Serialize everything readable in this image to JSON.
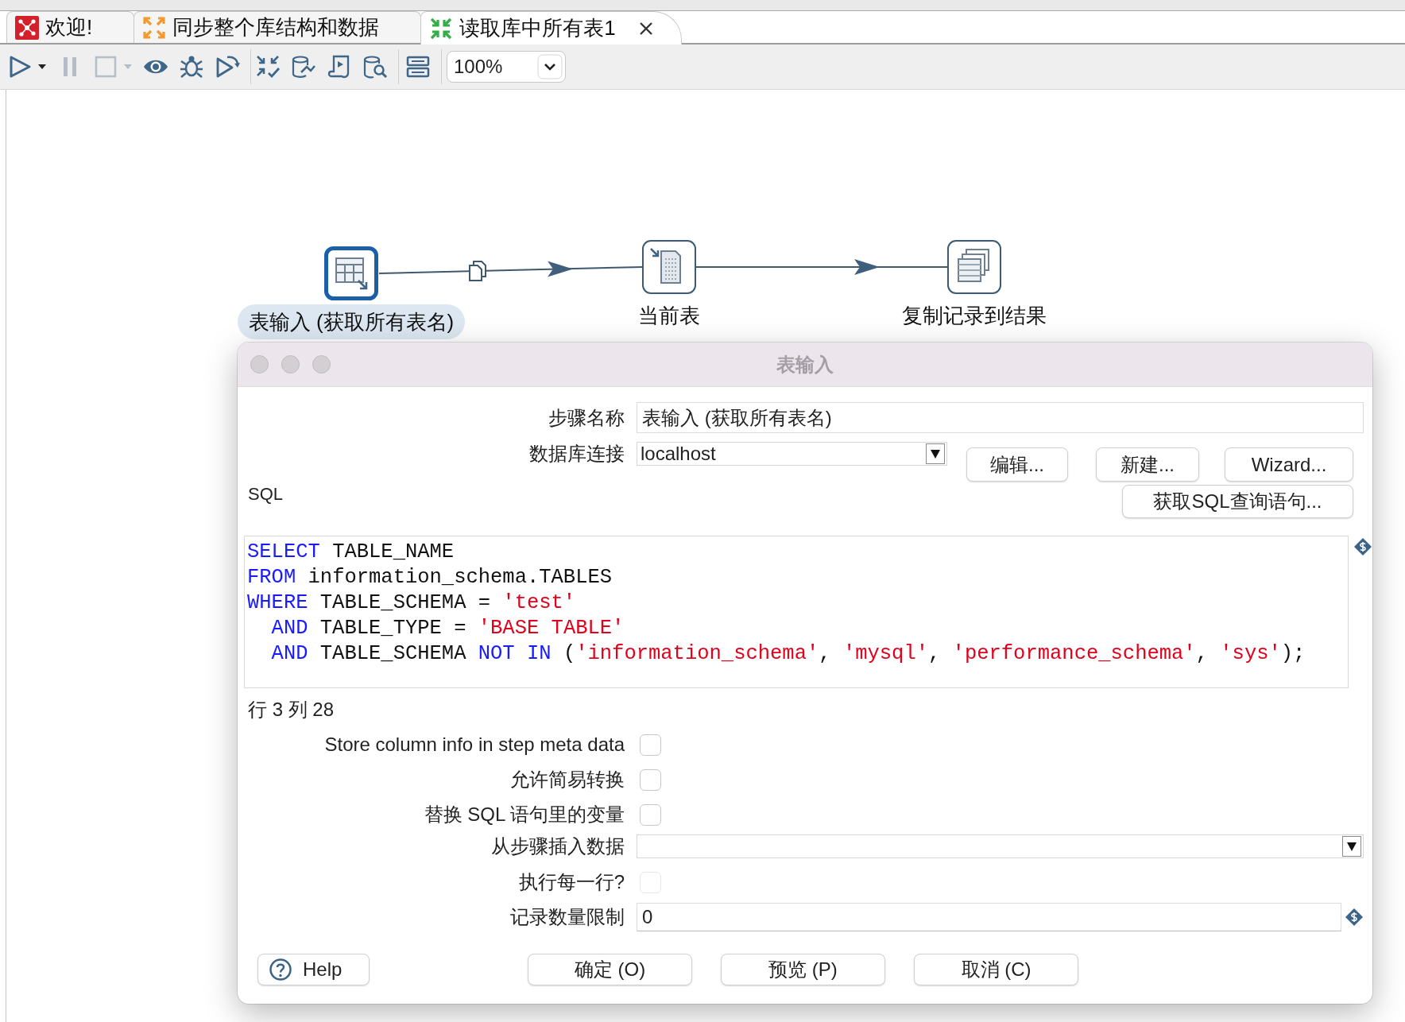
{
  "tabs": [
    {
      "label": "欢迎!",
      "kind": "welcome",
      "selected": false,
      "closable": false
    },
    {
      "label": "同步整个库结构和数据",
      "kind": "job",
      "selected": false,
      "closable": false
    },
    {
      "label": "读取库中所有表1",
      "kind": "transformation",
      "selected": true,
      "closable": true
    }
  ],
  "toolbar": {
    "groups": [
      [
        {
          "kind": "run",
          "dropdown": true,
          "disabled": false
        },
        {
          "kind": "pause",
          "dropdown": false,
          "disabled": true
        },
        {
          "kind": "stop",
          "dropdown": true,
          "disabled": true
        },
        {
          "kind": "preview",
          "dropdown": false,
          "disabled": false
        },
        {
          "kind": "debug",
          "dropdown": false,
          "disabled": false
        },
        {
          "kind": "replay",
          "dropdown": false,
          "disabled": false
        }
      ],
      [
        {
          "kind": "verify",
          "dropdown": false,
          "disabled": false
        },
        {
          "kind": "impact",
          "dropdown": false,
          "disabled": false
        },
        {
          "kind": "sql",
          "dropdown": false,
          "disabled": false
        },
        {
          "kind": "explore",
          "dropdown": false,
          "disabled": false
        }
      ],
      [
        {
          "kind": "layout",
          "dropdown": false,
          "disabled": false
        }
      ]
    ],
    "zoom": "100%"
  },
  "canvas": {
    "steps": [
      {
        "name": "表输入 (获取所有表名)",
        "kind": "table-input",
        "selected": true
      },
      {
        "name": "当前表",
        "kind": "current-table",
        "selected": false
      },
      {
        "name": "复制记录到结果",
        "kind": "copy-rows",
        "selected": false
      }
    ],
    "hops": [
      {
        "copy": true
      },
      {
        "copy": false
      }
    ]
  },
  "dialog": {
    "title": "表输入",
    "step_name": {
      "label": "步骤名称",
      "value": "表输入 (获取所有表名)"
    },
    "connection": {
      "label": "数据库连接",
      "value": "localhost",
      "buttons": [
        "编辑...",
        "新建...",
        "Wizard..."
      ]
    },
    "sql": {
      "label": "SQL",
      "button": "获取SQL查询语句...",
      "variable": true,
      "lines": [
        {
          "indented": false,
          "tokens": [
            {
              "kind": "keyword",
              "text": "SELECT"
            },
            {
              "kind": "plain",
              "text": " TABLE_NAME"
            }
          ]
        },
        {
          "indented": false,
          "tokens": [
            {
              "kind": "keyword",
              "text": "FROM"
            },
            {
              "kind": "plain",
              "text": " information_schema.TABLES"
            }
          ]
        },
        {
          "indented": false,
          "tokens": [
            {
              "kind": "keyword",
              "text": "WHERE"
            },
            {
              "kind": "plain",
              "text": " TABLE_SCHEMA = "
            },
            {
              "kind": "string",
              "text": "'test'"
            }
          ]
        },
        {
          "indented": true,
          "tokens": [
            {
              "kind": "keyword",
              "text": "AND"
            },
            {
              "kind": "plain",
              "text": " TABLE_TYPE = "
            },
            {
              "kind": "string",
              "text": "'BASE TABLE'"
            }
          ]
        },
        {
          "indented": true,
          "tokens": [
            {
              "kind": "keyword",
              "text": "AND"
            },
            {
              "kind": "plain",
              "text": " TABLE_SCHEMA "
            },
            {
              "kind": "keyword",
              "text": "NOT IN"
            },
            {
              "kind": "plain",
              "text": " ("
            },
            {
              "kind": "string",
              "text": "'information_schema'"
            },
            {
              "kind": "plain",
              "text": ", "
            },
            {
              "kind": "string",
              "text": "'mysql'"
            },
            {
              "kind": "plain",
              "text": ", "
            },
            {
              "kind": "string",
              "text": "'performance_schema'"
            },
            {
              "kind": "plain",
              "text": ", "
            },
            {
              "kind": "string",
              "text": "'sys'"
            },
            {
              "kind": "plain",
              "text": ");"
            }
          ]
        }
      ],
      "position": "行 3 列 28"
    },
    "options": [
      {
        "kind": "checkbox",
        "label": "Store column info in step meta data",
        "checked": false,
        "disabled": false
      },
      {
        "kind": "checkbox",
        "label": "允许简易转换",
        "checked": false,
        "disabled": false
      },
      {
        "kind": "checkbox",
        "label": "替换 SQL 语句里的变量",
        "checked": false,
        "disabled": false
      },
      {
        "kind": "select",
        "label": "从步骤插入数据"
      },
      {
        "kind": "checkbox",
        "label": "执行每一行?",
        "checked": false,
        "disabled": true
      },
      {
        "kind": "text",
        "label": "记录数量限制",
        "value": "0",
        "variable": true
      }
    ],
    "buttons": [
      {
        "kind": "help",
        "label": "Help"
      },
      {
        "kind": "plain",
        "label": "确定 (O)"
      },
      {
        "kind": "plain",
        "label": "预览 (P)"
      },
      {
        "kind": "plain",
        "label": "取消 (C)"
      }
    ]
  }
}
